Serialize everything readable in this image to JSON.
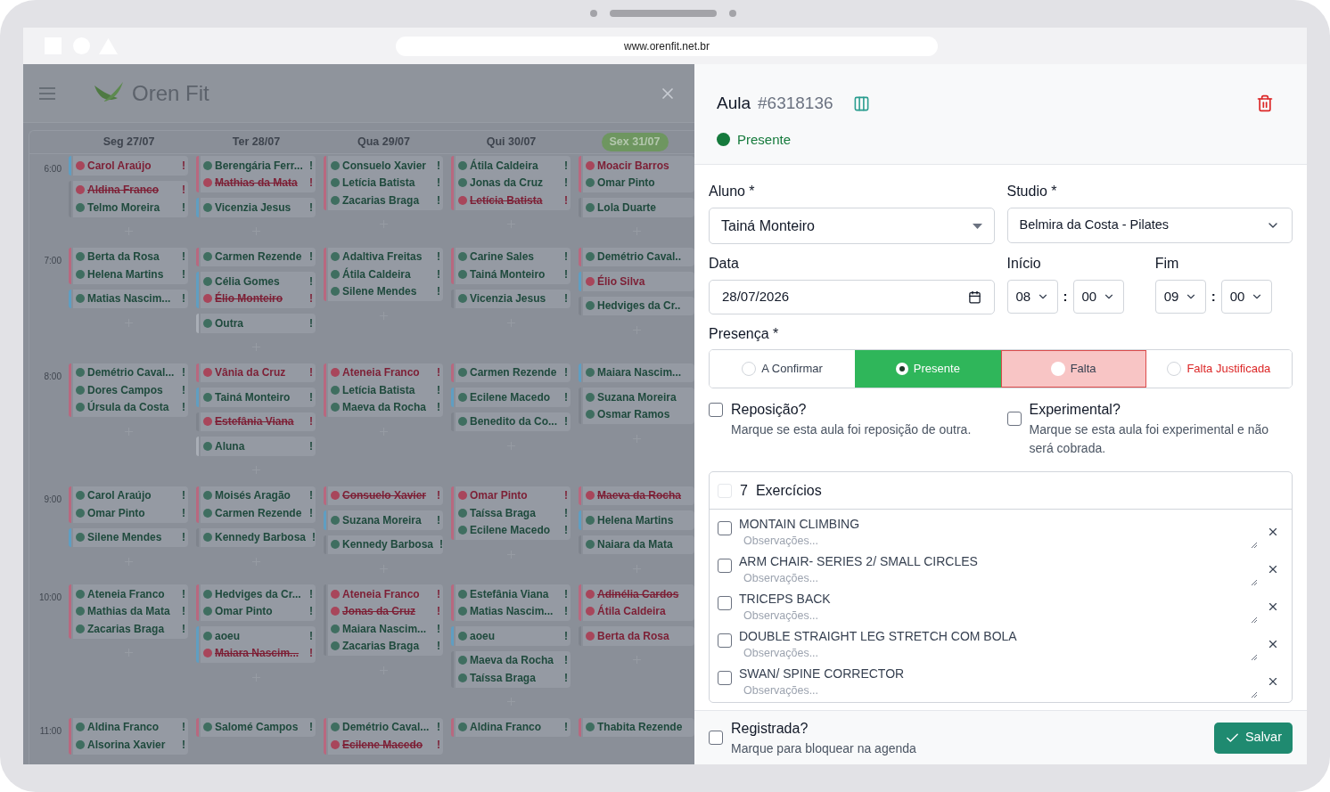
{
  "browser": {
    "url": "www.orenfit.net.br"
  },
  "app": {
    "brand": "Oren Fit",
    "days": [
      {
        "label": "Seg 27/07",
        "selected": false
      },
      {
        "label": "Ter 28/07",
        "selected": false
      },
      {
        "label": "Qua 29/07",
        "selected": false
      },
      {
        "label": "Qui 30/07",
        "selected": false
      },
      {
        "label": "Sex 31/07",
        "selected": true
      }
    ],
    "slots": [
      {
        "time": "6:00",
        "columns": [
          [
            {
              "color": "#5f9ec2",
              "entries": [
                {
                  "name": "Carol Araújo",
                  "absent": true,
                  "cancelled": false,
                  "mark": "!"
                }
              ]
            },
            {
              "color": "#7f848d",
              "entries": [
                {
                  "name": "Aldina Franco",
                  "absent": true,
                  "cancelled": true,
                  "mark": "!"
                },
                {
                  "name": "Telmo Moreira",
                  "absent": false,
                  "cancelled": false,
                  "mark": "!"
                }
              ]
            }
          ],
          [
            {
              "color": "#b8687f",
              "entries": [
                {
                  "name": "Berengária Ferr...",
                  "absent": false,
                  "cancelled": false,
                  "mark": "!"
                },
                {
                  "name": "Mathias da Mata",
                  "absent": true,
                  "cancelled": true,
                  "mark": "!"
                }
              ]
            },
            {
              "color": "#5f9ec2",
              "entries": [
                {
                  "name": "Vicenzia Jesus",
                  "absent": false,
                  "cancelled": false,
                  "mark": "!"
                }
              ]
            }
          ],
          [
            {
              "color": "#b8687f",
              "entries": [
                {
                  "name": "Consuelo Xavier",
                  "absent": false,
                  "cancelled": false,
                  "mark": "!"
                },
                {
                  "name": "Letícia Batista",
                  "absent": false,
                  "cancelled": false,
                  "mark": "!"
                },
                {
                  "name": "Zacarias Braga",
                  "absent": false,
                  "cancelled": false,
                  "mark": "!"
                }
              ]
            }
          ],
          [
            {
              "color": "#b8687f",
              "entries": [
                {
                  "name": "Átila Caldeira",
                  "absent": false,
                  "cancelled": false,
                  "mark": "!"
                },
                {
                  "name": "Jonas da Cruz",
                  "absent": false,
                  "cancelled": false,
                  "mark": "!"
                },
                {
                  "name": "Letícia Batista",
                  "absent": true,
                  "cancelled": true,
                  "mark": "!"
                }
              ]
            }
          ],
          [
            {
              "color": "#b8687f",
              "entries": [
                {
                  "name": "Moacir Barros",
                  "absent": true,
                  "cancelled": false
                },
                {
                  "name": "Omar Pinto",
                  "absent": false,
                  "cancelled": false
                }
              ]
            },
            {
              "color": "#7f848d",
              "entries": [
                {
                  "name": "Lola Duarte",
                  "absent": false,
                  "cancelled": false
                }
              ]
            }
          ]
        ]
      },
      {
        "time": "7:00",
        "columns": [
          [
            {
              "color": "#b8687f",
              "entries": [
                {
                  "name": "Berta da Rosa",
                  "absent": false,
                  "cancelled": false,
                  "mark": "!"
                },
                {
                  "name": "Helena Martins",
                  "absent": false,
                  "cancelled": false,
                  "mark": "!"
                }
              ]
            },
            {
              "color": "#5f9ec2",
              "entries": [
                {
                  "name": "Matias Nascim...",
                  "absent": false,
                  "cancelled": false,
                  "mark": "!"
                }
              ]
            }
          ],
          [
            {
              "color": "#b8687f",
              "entries": [
                {
                  "name": "Carmen Rezende",
                  "absent": false,
                  "cancelled": false,
                  "mark": "!"
                }
              ]
            },
            {
              "color": "#5f9ec2",
              "entries": [
                {
                  "name": "Célia Gomes",
                  "absent": false,
                  "cancelled": false,
                  "mark": "!"
                },
                {
                  "name": "Élio Monteiro",
                  "absent": true,
                  "cancelled": true,
                  "mark": "!"
                }
              ]
            },
            {
              "color": "#a9aeb6",
              "entries": [
                {
                  "name": "Outra",
                  "absent": false,
                  "cancelled": false,
                  "mark": "!"
                }
              ]
            }
          ],
          [
            {
              "color": "#b8687f",
              "entries": [
                {
                  "name": "Adaltiva Freitas",
                  "absent": false,
                  "cancelled": false,
                  "mark": "!"
                },
                {
                  "name": "Átila Caldeira",
                  "absent": false,
                  "cancelled": false,
                  "mark": "!"
                },
                {
                  "name": "Silene Mendes",
                  "absent": false,
                  "cancelled": false,
                  "mark": "!"
                }
              ]
            }
          ],
          [
            {
              "color": "#b8687f",
              "entries": [
                {
                  "name": "Carine Sales",
                  "absent": false,
                  "cancelled": false,
                  "mark": "!"
                },
                {
                  "name": "Tainá Monteiro",
                  "absent": false,
                  "cancelled": false,
                  "mark": "!"
                }
              ]
            },
            {
              "color": "#7f848d",
              "entries": [
                {
                  "name": "Vicenzia Jesus",
                  "absent": false,
                  "cancelled": false,
                  "mark": "!"
                }
              ]
            }
          ],
          [
            {
              "color": "#b8687f",
              "entries": [
                {
                  "name": "Demétrio Caval..",
                  "absent": false,
                  "cancelled": false
                }
              ]
            },
            {
              "color": "#5f9ec2",
              "entries": [
                {
                  "name": "Élio Silva",
                  "absent": true,
                  "cancelled": false
                }
              ]
            },
            {
              "color": "#7f848d",
              "entries": [
                {
                  "name": "Hedviges da Cr..",
                  "absent": false,
                  "cancelled": false
                }
              ]
            }
          ]
        ]
      },
      {
        "time": "8:00",
        "columns": [
          [
            {
              "color": "#b8687f",
              "entries": [
                {
                  "name": "Demétrio Caval...",
                  "absent": false,
                  "cancelled": false,
                  "mark": "!"
                },
                {
                  "name": "Dores Campos",
                  "absent": false,
                  "cancelled": false,
                  "mark": "!"
                },
                {
                  "name": "Úrsula da Costa",
                  "absent": false,
                  "cancelled": false,
                  "mark": "!"
                }
              ]
            }
          ],
          [
            {
              "color": "#b8687f",
              "entries": [
                {
                  "name": "Vânia da Cruz",
                  "absent": true,
                  "cancelled": false,
                  "mark": "!"
                }
              ]
            },
            {
              "color": "#5f9ec2",
              "entries": [
                {
                  "name": "Tainá Monteiro",
                  "absent": false,
                  "cancelled": false,
                  "mark": "!"
                }
              ]
            },
            {
              "color": "#7f848d",
              "entries": [
                {
                  "name": "Estefânia Viana",
                  "absent": true,
                  "cancelled": true,
                  "mark": "!"
                }
              ]
            },
            {
              "color": "#a9aeb6",
              "entries": [
                {
                  "name": "Aluna",
                  "absent": false,
                  "cancelled": false,
                  "mark": "!"
                }
              ]
            }
          ],
          [
            {
              "color": "#b8687f",
              "entries": [
                {
                  "name": "Ateneia Franco",
                  "absent": true,
                  "cancelled": false,
                  "mark": "!"
                },
                {
                  "name": "Letícia Batista",
                  "absent": false,
                  "cancelled": false,
                  "mark": "!"
                },
                {
                  "name": "Maeva da Rocha",
                  "absent": false,
                  "cancelled": false,
                  "mark": "!"
                }
              ]
            }
          ],
          [
            {
              "color": "#b8687f",
              "entries": [
                {
                  "name": "Carmen Rezende",
                  "absent": false,
                  "cancelled": false,
                  "mark": "!"
                }
              ]
            },
            {
              "color": "#5f9ec2",
              "entries": [
                {
                  "name": "Ecilene Macedo",
                  "absent": false,
                  "cancelled": false,
                  "mark": "!"
                }
              ]
            },
            {
              "color": "#7f848d",
              "entries": [
                {
                  "name": "Benedito da Co...",
                  "absent": false,
                  "cancelled": false,
                  "mark": "!"
                }
              ]
            }
          ],
          [
            {
              "color": "#5f9ec2",
              "entries": [
                {
                  "name": "Maiara Nascim...",
                  "absent": false,
                  "cancelled": false
                }
              ]
            },
            {
              "color": "#7f848d",
              "entries": [
                {
                  "name": "Suzana Moreira",
                  "absent": false,
                  "cancelled": false
                },
                {
                  "name": "Osmar Ramos",
                  "absent": false,
                  "cancelled": false
                }
              ]
            }
          ]
        ]
      },
      {
        "time": "9:00",
        "columns": [
          [
            {
              "color": "#b8687f",
              "entries": [
                {
                  "name": "Carol Araújo",
                  "absent": false,
                  "cancelled": false,
                  "mark": "!"
                },
                {
                  "name": "Omar Pinto",
                  "absent": false,
                  "cancelled": false,
                  "mark": "!"
                }
              ]
            },
            {
              "color": "#5f9ec2",
              "entries": [
                {
                  "name": "Silene Mendes",
                  "absent": false,
                  "cancelled": false,
                  "mark": "!"
                }
              ]
            }
          ],
          [
            {
              "color": "#b8687f",
              "entries": [
                {
                  "name": "Moisés Aragão",
                  "absent": false,
                  "cancelled": false,
                  "mark": "!"
                },
                {
                  "name": "Carmen Rezende",
                  "absent": false,
                  "cancelled": false,
                  "mark": "!"
                }
              ]
            },
            {
              "color": "#7f848d",
              "entries": [
                {
                  "name": "Kennedy Barbosa",
                  "absent": false,
                  "cancelled": false,
                  "mark": "!"
                }
              ]
            }
          ],
          [
            {
              "color": "#b8687f",
              "entries": [
                {
                  "name": "Consuelo Xavier",
                  "absent": true,
                  "cancelled": true,
                  "mark": "!"
                }
              ]
            },
            {
              "color": "#5f9ec2",
              "entries": [
                {
                  "name": "Suzana Moreira",
                  "absent": false,
                  "cancelled": false,
                  "mark": "!"
                }
              ]
            },
            {
              "color": "#7f848d",
              "entries": [
                {
                  "name": "Kennedy Barbosa",
                  "absent": false,
                  "cancelled": false,
                  "mark": "!"
                }
              ]
            }
          ],
          [
            {
              "color": "#b8687f",
              "entries": [
                {
                  "name": "Omar Pinto",
                  "absent": true,
                  "cancelled": false,
                  "mark": "!"
                },
                {
                  "name": "Taíssa Braga",
                  "absent": false,
                  "cancelled": false,
                  "mark": "!"
                },
                {
                  "name": "Ecilene Macedo",
                  "absent": false,
                  "cancelled": false,
                  "mark": "!"
                }
              ]
            }
          ],
          [
            {
              "color": "#b8687f",
              "entries": [
                {
                  "name": "Maeva da Rocha",
                  "absent": true,
                  "cancelled": true
                }
              ]
            },
            {
              "color": "#5f9ec2",
              "entries": [
                {
                  "name": "Helena Martins",
                  "absent": false,
                  "cancelled": false
                }
              ]
            },
            {
              "color": "#7f848d",
              "entries": [
                {
                  "name": "Naiara da Mata",
                  "absent": false,
                  "cancelled": false
                }
              ]
            }
          ]
        ]
      },
      {
        "time": "10:00",
        "columns": [
          [
            {
              "color": "#b8687f",
              "entries": [
                {
                  "name": "Ateneia Franco",
                  "absent": false,
                  "cancelled": false,
                  "mark": "!"
                },
                {
                  "name": "Mathias da Mata",
                  "absent": false,
                  "cancelled": false,
                  "mark": "!"
                },
                {
                  "name": "Zacarias Braga",
                  "absent": false,
                  "cancelled": false,
                  "mark": "!"
                }
              ]
            }
          ],
          [
            {
              "color": "#b8687f",
              "entries": [
                {
                  "name": "Hedviges da Cr...",
                  "absent": false,
                  "cancelled": false,
                  "mark": "!"
                },
                {
                  "name": "Omar Pinto",
                  "absent": false,
                  "cancelled": false,
                  "mark": "!"
                }
              ]
            },
            {
              "color": "#5f9ec2",
              "entries": [
                {
                  "name": "aoeu",
                  "absent": false,
                  "cancelled": false,
                  "mark": "!"
                },
                {
                  "name": "Maiara Nascim...",
                  "absent": true,
                  "cancelled": true,
                  "mark": "!"
                }
              ]
            }
          ],
          [
            {
              "color": "#7f848d",
              "entries": [
                {
                  "name": "Ateneia Franco",
                  "absent": true,
                  "cancelled": false,
                  "mark": "!"
                },
                {
                  "name": "Jonas da Cruz",
                  "absent": true,
                  "cancelled": true,
                  "mark": "!"
                },
                {
                  "name": "Maiara Nascim...",
                  "absent": false,
                  "cancelled": false,
                  "mark": "!"
                },
                {
                  "name": "Zacarias Braga",
                  "absent": false,
                  "cancelled": false,
                  "mark": "!"
                }
              ]
            }
          ],
          [
            {
              "color": "#b8687f",
              "entries": [
                {
                  "name": "Estefânia Viana",
                  "absent": false,
                  "cancelled": false,
                  "mark": "!"
                },
                {
                  "name": "Matias Nascim...",
                  "absent": false,
                  "cancelled": false,
                  "mark": "!"
                }
              ]
            },
            {
              "color": "#5f9ec2",
              "entries": [
                {
                  "name": "aoeu",
                  "absent": false,
                  "cancelled": false,
                  "mark": "!"
                }
              ]
            },
            {
              "color": "#7f848d",
              "entries": [
                {
                  "name": "Maeva da Rocha",
                  "absent": false,
                  "cancelled": false,
                  "mark": "!"
                },
                {
                  "name": "Taíssa Braga",
                  "absent": false,
                  "cancelled": false,
                  "mark": "!"
                }
              ]
            }
          ],
          [
            {
              "color": "#b8687f",
              "entries": [
                {
                  "name": "Adinélia Cardos",
                  "absent": true,
                  "cancelled": true
                },
                {
                  "name": "Átila Caldeira",
                  "absent": true,
                  "cancelled": false
                }
              ]
            },
            {
              "color": "#7f848d",
              "entries": [
                {
                  "name": "Berta da Rosa",
                  "absent": true,
                  "cancelled": false
                }
              ]
            }
          ]
        ]
      },
      {
        "time": "11:00",
        "columns": [
          [
            {
              "color": "#b8687f",
              "entries": [
                {
                  "name": "Aldina Franco",
                  "absent": false,
                  "cancelled": false,
                  "mark": "!"
                },
                {
                  "name": "Alsorina Xavier",
                  "absent": false,
                  "cancelled": false,
                  "mark": "!"
                }
              ]
            }
          ],
          [
            {
              "color": "#b8687f",
              "entries": [
                {
                  "name": "Salomé Campos",
                  "absent": false,
                  "cancelled": false,
                  "mark": "!"
                }
              ]
            }
          ],
          [
            {
              "color": "#b8687f",
              "entries": [
                {
                  "name": "Demétrio Caval...",
                  "absent": false,
                  "cancelled": false,
                  "mark": "!"
                },
                {
                  "name": "Ecilene Macedo",
                  "absent": true,
                  "cancelled": true,
                  "mark": "!"
                }
              ]
            }
          ],
          [
            {
              "color": "#b8687f",
              "entries": [
                {
                  "name": "Aldina Franco",
                  "absent": false,
                  "cancelled": false,
                  "mark": "!"
                }
              ]
            }
          ],
          [
            {
              "color": "#b8687f",
              "entries": [
                {
                  "name": "Thabita Rezende",
                  "absent": false,
                  "cancelled": false
                }
              ]
            }
          ]
        ]
      }
    ]
  },
  "panel": {
    "title": "Aula",
    "code": "#6318136",
    "status": {
      "label": "Presente",
      "kind": "success"
    },
    "student": {
      "label": "Aluno *",
      "value": "Tainá Monteiro"
    },
    "studio": {
      "label": "Studio *",
      "value": "Belmira da Costa - Pilates"
    },
    "date": {
      "label": "Data",
      "value": "28/07/2026"
    },
    "start": {
      "label": "Início",
      "hour": "08",
      "separator": ":",
      "minute": "00"
    },
    "end": {
      "label": "Fim",
      "hour": "09",
      "separator": ":",
      "minute": "00"
    },
    "presence": {
      "label": "Presença *",
      "options": [
        {
          "label": "A Confirmar",
          "kind": "neutral",
          "selected": false,
          "hovered": false
        },
        {
          "label": "Presente",
          "kind": "success",
          "selected": true,
          "hovered": false
        },
        {
          "label": "Falta",
          "kind": "danger",
          "selected": false,
          "hovered": true
        },
        {
          "label": "Falta Justificada",
          "kind": "danger",
          "selected": false,
          "hovered": false
        }
      ]
    },
    "checks": [
      {
        "title": "Reposição?",
        "description": "Marque se esta aula foi reposição de outra.",
        "checked": false
      },
      {
        "title": "Experimental?",
        "description": "Marque se esta aula foi experimental e não será cobrada.",
        "checked": false
      }
    ],
    "exercises": {
      "count": "7",
      "title": "Exercícios",
      "checked": false,
      "items": [
        {
          "name": "MONTAIN CLIMBING",
          "placeholder": "Observações...",
          "checked": false
        },
        {
          "name": "ARM CHAIR- SERIES 2/ SMALL CIRCLES",
          "placeholder": "Observações...",
          "checked": false
        },
        {
          "name": "TRICEPS BACK",
          "placeholder": "Observações...",
          "checked": false
        },
        {
          "name": "DOUBLE STRAIGHT LEG STRETCH COM BOLA",
          "placeholder": "Observações...",
          "checked": false
        },
        {
          "name": "SWAN/ SPINE CORRECTOR",
          "placeholder": "Observações...",
          "checked": false
        }
      ]
    },
    "registered": {
      "title": "Registrada?",
      "description": "Marque para bloquear na agenda",
      "checked": false
    },
    "save": "Salvar"
  }
}
